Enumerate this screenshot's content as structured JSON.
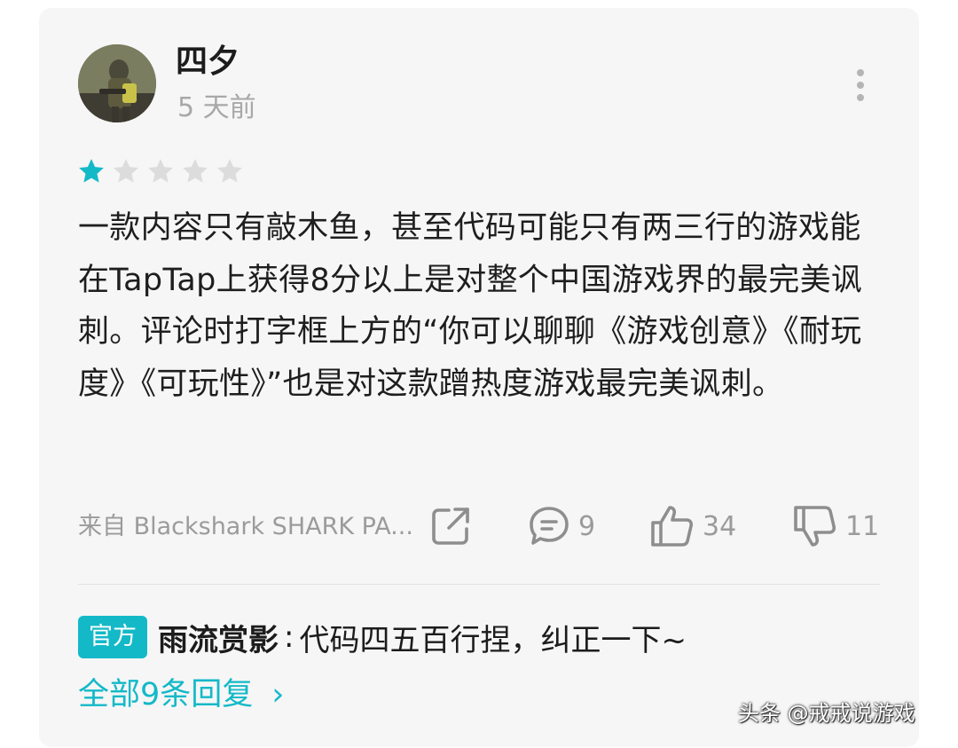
{
  "user": {
    "name": "四夕",
    "time": "5 天前"
  },
  "rating": {
    "value": 1,
    "max": 5,
    "filled_color": "#14b9c8",
    "empty_color": "#dcdcdc"
  },
  "review": {
    "text": "一款内容只有敲木鱼，甚至代码可能只有两三行的游戏能在TapTap上获得8分以上是对整个中国游戏界的最完美讽刺。评论时打字框上方的“你可以聊聊《游戏创意》《耐玩度》《可玩性》”也是对这款蹭热度游戏最完美讽刺。"
  },
  "footer": {
    "device": "来自 Blackshark SHARK PA...",
    "share_icon": "share-icon",
    "comment_count": "9",
    "like_count": "34",
    "dislike_count": "11"
  },
  "reply": {
    "badge": "官方",
    "author": "雨流赏影",
    "separator": ":",
    "text": "代码四五百行捏，纠正一下~"
  },
  "all_replies": {
    "label": "全部9条回复",
    "chevron": "›"
  },
  "watermark": "头条 @戒戒说游戏",
  "colors": {
    "accent": "#14b9c8",
    "card_bg": "#f6f6f6",
    "muted_text": "#9b9b9b"
  }
}
